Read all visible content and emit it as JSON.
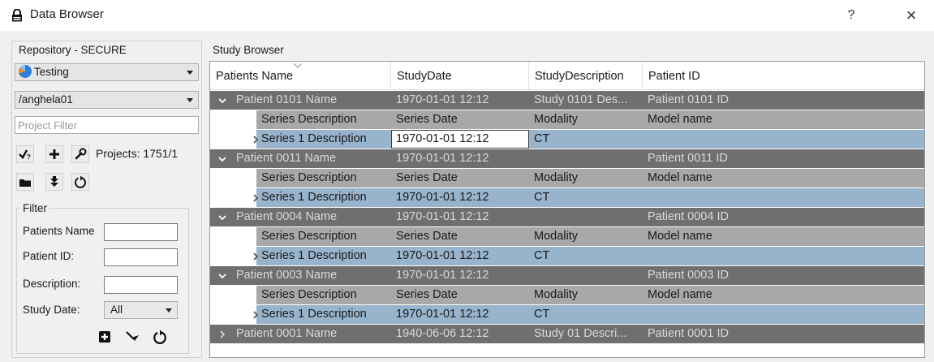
{
  "window": {
    "title": "Data Browser",
    "help": "?",
    "close": "×"
  },
  "repository": {
    "group_title": "Repository - SECURE",
    "server": "Testing",
    "user": "/anghela01",
    "project_filter_placeholder": "Project Filter",
    "projects_text": "Projects: 1751/1"
  },
  "filter": {
    "title": "Filter",
    "labels": {
      "patients_name": "Patients Name",
      "patient_id": "Patient ID:",
      "description": "Description:",
      "study_date": "Study Date:"
    },
    "study_date_value": "All"
  },
  "study_browser": {
    "title": "Study Browser",
    "columns": [
      "Patients Name",
      "StudyDate",
      "StudyDescription",
      "Patient ID"
    ],
    "patients": [
      {
        "name": "Patient 0101 Name",
        "date": "1970-01-01 12:12",
        "description": "Study 0101 Des...",
        "id": "Patient 0101 ID",
        "expanded": true,
        "sub_header": [
          "Series Description",
          "Series Date",
          "Modality",
          "Model name"
        ],
        "series": [
          "Series 1 Description",
          "1970-01-01 12:12",
          "CT",
          ""
        ]
      },
      {
        "name": "Patient 0011 Name",
        "date": "1970-01-01 12:12",
        "description": "",
        "id": "Patient 0011 ID",
        "expanded": true,
        "sub_header": [
          "Series Description",
          "Series Date",
          "Modality",
          "Model name"
        ],
        "series": [
          "Series 1 Description",
          "1970-01-01 12:12",
          "CT",
          ""
        ]
      },
      {
        "name": "Patient 0004 Name",
        "date": "1970-01-01 12:12",
        "description": "",
        "id": "Patient 0004 ID",
        "expanded": true,
        "sub_header": [
          "Series Description",
          "Series Date",
          "Modality",
          "Model name"
        ],
        "series": [
          "Series 1 Description",
          "1970-01-01 12:12",
          "CT",
          ""
        ]
      },
      {
        "name": "Patient 0003 Name",
        "date": "1970-01-01 12:12",
        "description": "",
        "id": "Patient 0003 ID",
        "expanded": true,
        "sub_header": [
          "Series Description",
          "Series Date",
          "Modality",
          "Model name"
        ],
        "series": [
          "Series 1 Description",
          "1970-01-01 12:12",
          "CT",
          ""
        ]
      },
      {
        "name": "Patient 0001 Name",
        "date": "1940-06-06 12:12",
        "description": "Study 01 Descri...",
        "id": "Patient 0001 ID",
        "expanded": false
      }
    ]
  },
  "colors": {
    "patient_row": "#6f6f6f",
    "sub_header_row": "#a8a8a8",
    "series_row": "#98b4cc"
  }
}
